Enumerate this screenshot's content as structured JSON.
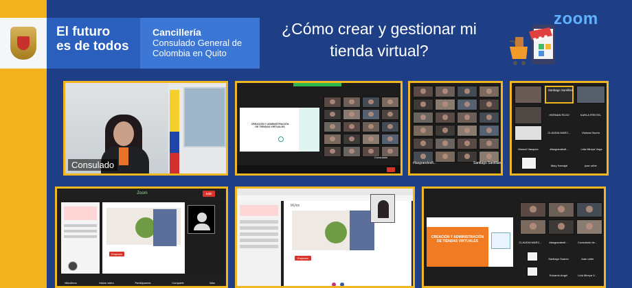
{
  "banner": {
    "slogan_line1": "El futuro",
    "slogan_line2": "es de todos",
    "org_title": "Cancillería",
    "org_line1": "Consulado General de",
    "org_line2": "Colombia en Quito",
    "headline_line1": "¿Cómo crear y gestionar mi",
    "headline_line2": "tienda virtual?",
    "zoom_logo": "zoom"
  },
  "speaker": {
    "name_label": "Consulado"
  },
  "screen_share": {
    "slide_title": "CREACIÓN Y ADMINISTRACIÓN DE TIENDAS VIRTUALES",
    "presenter": "Consulado"
  },
  "gallery_small": {
    "labels": [
      "#lasgrandesfi...",
      "Santiago Santillan"
    ]
  },
  "gallery_names": {
    "top": "Santiago Santillan",
    "rows": [
      [
        "HERNAN ROJO",
        "KARLA FREITEL"
      ],
      [
        "CLAUDIA MARC...",
        "Viviana Osorio"
      ],
      [
        "Manuel Vasquez",
        "#lasgrandesfi...",
        "Lida Mireya Vega"
      ],
      [
        "",
        "Mary Karvajal",
        "juan uribe"
      ]
    ]
  },
  "zoom_window": {
    "title": "Zoom",
    "end_label": "Salir",
    "start_button": "Empezar",
    "toolbar": [
      "Micrófono",
      "Iniciar video",
      "Participantes",
      "Compartir",
      "Más"
    ]
  },
  "browser_window": {
    "tab_label": "Mylon",
    "start_button": "Empezar"
  },
  "gallery_slide": {
    "slide_title": "CREACIÓN Y ADMINISTRACIÓN DE TIENDAS VIRTUALES",
    "names": [
      "CLAUDIA MARC...",
      "#lasgrandesfi...",
      "Consulado de...",
      "Santiago Suarez",
      "Juan uribe",
      "Eduardo Angel",
      "Lida Mireya V..."
    ]
  },
  "colors": {
    "yellow": "#f2b21d",
    "blue_dark": "#1e3f86",
    "blue_banner": "#2a5fbd",
    "blue_panel": "#3c77d6",
    "zoom_blue": "#5fb2ff",
    "tile_border": "#f1b71c",
    "slide_orange": "#f07b22"
  }
}
